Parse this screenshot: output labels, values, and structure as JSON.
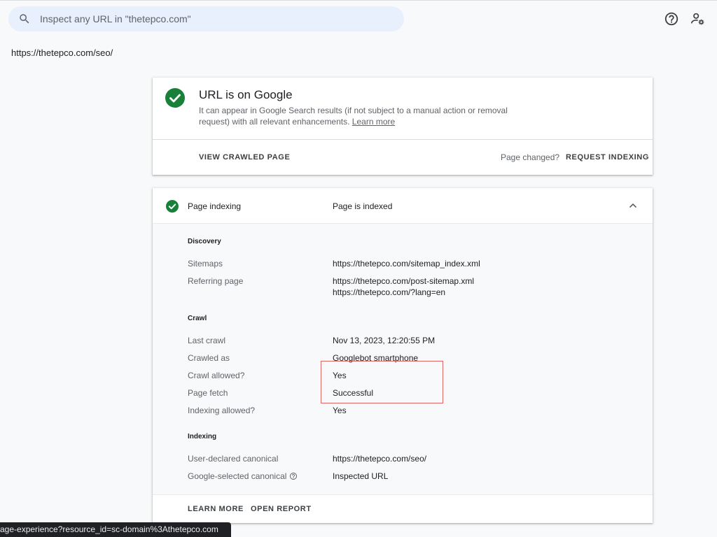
{
  "search": {
    "placeholder": "Inspect any URL in \"thetepco.com\""
  },
  "inspected_url": "https://thetepco.com/seo/",
  "status_card": {
    "title": "URL is on Google",
    "description": "It can appear in Google Search results (if not subject to a manual action or removal request) with all relevant enhancements.",
    "learn_more": "Learn more",
    "view_crawled": "VIEW CRAWLED PAGE",
    "page_changed": "Page changed?",
    "request_indexing": "REQUEST INDEXING"
  },
  "indexing_card": {
    "label": "Page indexing",
    "status": "Page is indexed",
    "discovery": {
      "heading": "Discovery",
      "sitemaps_label": "Sitemaps",
      "sitemaps_value": "https://thetepco.com/sitemap_index.xml",
      "referring_label": "Referring page",
      "referring_values": [
        "https://thetepco.com/post-sitemap.xml",
        "https://thetepco.com/?lang=en"
      ]
    },
    "crawl": {
      "heading": "Crawl",
      "rows": [
        {
          "label": "Last crawl",
          "value": "Nov 13, 2023, 12:20:55 PM"
        },
        {
          "label": "Crawled as",
          "value": "Googlebot smartphone"
        },
        {
          "label": "Crawl allowed?",
          "value": "Yes"
        },
        {
          "label": "Page fetch",
          "value": "Successful"
        },
        {
          "label": "Indexing allowed?",
          "value": "Yes"
        }
      ]
    },
    "indexing": {
      "heading": "Indexing",
      "user_canonical_label": "User-declared canonical",
      "user_canonical_value": "https://thetepco.com/seo/",
      "google_canonical_label": "Google-selected canonical",
      "google_canonical_value": "Inspected URL"
    },
    "learn_more": "LEARN MORE",
    "open_report": "OPEN REPORT"
  },
  "status_bar_url": "age-experience?resource_id=sc-domain%3Athetepco.com",
  "icons": {
    "search": "search-icon",
    "help": "help-icon",
    "account_settings": "manage-accounts-icon",
    "check": "check-circle-icon",
    "collapse": "chevron-up-icon"
  },
  "colors": {
    "accent_green": "#188038",
    "highlight_red": "#e06666",
    "search_bg": "#e8f0fe"
  }
}
